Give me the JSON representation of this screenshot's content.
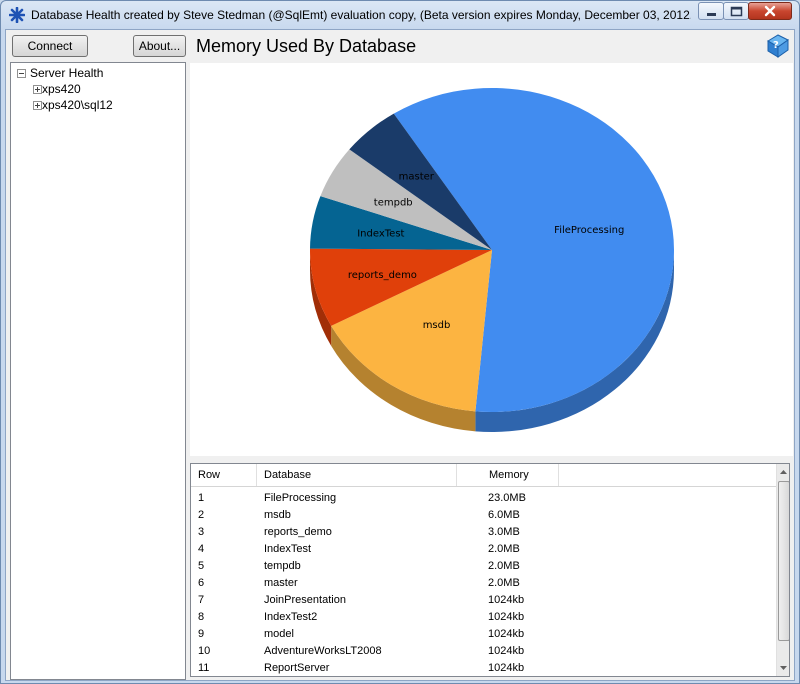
{
  "window": {
    "title": "Database Health created by Steve Stedman (@SqlEmt) evaluation copy, (Beta version expires Monday, December 03, 2012..."
  },
  "toolbar": {
    "connect_label": "Connect",
    "about_label": "About..."
  },
  "tree": {
    "root": "Server Health",
    "children": [
      "xps420",
      "xps420\\sql12"
    ]
  },
  "page": {
    "heading": "Memory Used By Database",
    "help_icon": "help-book-icon"
  },
  "colors": {
    "FileProcessing": "#418cf0",
    "msdb": "#fcb441",
    "reports_demo": "#e0400a",
    "IndexTest": "#056492",
    "tempdb": "#bfbfbf",
    "master": "#1a3b69"
  },
  "chart_data": {
    "type": "pie",
    "title": "Memory Used By Database",
    "unit": "MB",
    "categories": [
      "FileProcessing",
      "msdb",
      "reports_demo",
      "IndexTest",
      "tempdb",
      "master"
    ],
    "values": [
      23,
      6,
      3,
      2,
      2,
      2
    ],
    "labels_inside": true,
    "legend": "none",
    "three_d": true
  },
  "grid": {
    "columns": [
      "Row",
      "Database",
      "Memory"
    ],
    "rows": [
      [
        "1",
        "FileProcessing",
        "23.0MB"
      ],
      [
        "2",
        "msdb",
        "6.0MB"
      ],
      [
        "3",
        "reports_demo",
        "3.0MB"
      ],
      [
        "4",
        "IndexTest",
        "2.0MB"
      ],
      [
        "5",
        "tempdb",
        "2.0MB"
      ],
      [
        "6",
        "master",
        "2.0MB"
      ],
      [
        "7",
        "JoinPresentation",
        "1024kb"
      ],
      [
        "8",
        "IndexTest2",
        "1024kb"
      ],
      [
        "9",
        "model",
        "1024kb"
      ],
      [
        "10",
        "AdventureWorksLT2008",
        "1024kb"
      ],
      [
        "11",
        "ReportServer",
        "1024kb"
      ]
    ]
  }
}
